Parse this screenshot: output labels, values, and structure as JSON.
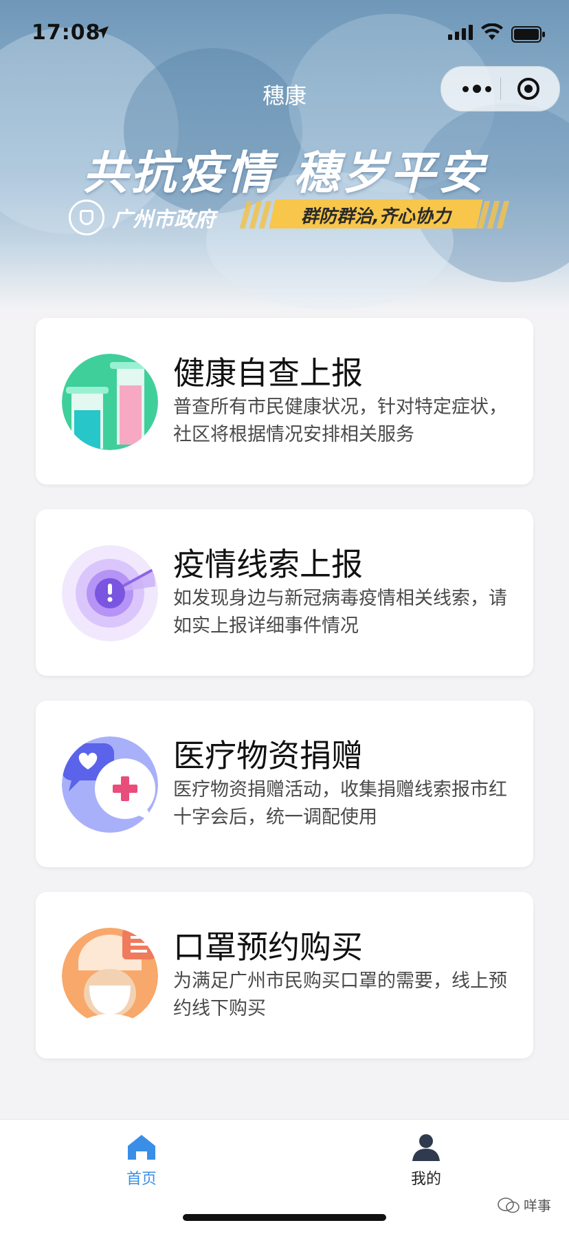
{
  "status_bar": {
    "time": "17:08"
  },
  "nav": {
    "title": "穗康"
  },
  "hero": {
    "slogan": "共抗疫情 穗岁平安",
    "gov_name": "广州市政府",
    "banner": "群防群治,齐心协力"
  },
  "cards": [
    {
      "title": "健康自查上报",
      "desc": "普查所有市民健康状况，针对特定症状，社区将根据情况安排相关服务",
      "icon": "test-tubes-icon",
      "color": "#3fd0a2"
    },
    {
      "title": "疫情线索上报",
      "desc": "如发现身边与新冠病毒疫情相关线索，请如实上报详细事件情况",
      "icon": "radar-alert-icon",
      "color": "#9a7cf0"
    },
    {
      "title": "医疗物资捐赠",
      "desc": "医疗物资捐赠活动，收集捐赠线索报市红十字会后，统一调配使用",
      "icon": "donation-chat-icon",
      "color": "#8e9cf5"
    },
    {
      "title": "口罩预约购买",
      "desc": "为满足广州市民购买口罩的需要，线上预约线下购买",
      "icon": "doctor-mask-icon",
      "color": "#f7a86a"
    }
  ],
  "tabbar": {
    "home": {
      "label": "首页",
      "active": true
    },
    "me": {
      "label": "我的",
      "active": false
    }
  },
  "watermark": "咩事",
  "colors": {
    "accent": "#3a8ee6",
    "banner": "#f7c64a"
  }
}
